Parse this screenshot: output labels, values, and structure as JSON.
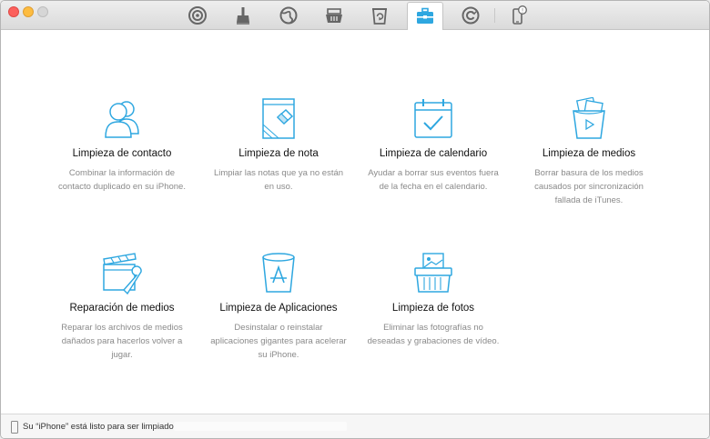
{
  "accent_color": "#2ea7e0",
  "toolbar": {
    "tabs": [
      {
        "name": "tab-signal",
        "icon": "signal-icon"
      },
      {
        "name": "tab-cleaner",
        "icon": "broom-icon"
      },
      {
        "name": "tab-globe",
        "icon": "globe-icon"
      },
      {
        "name": "tab-basket",
        "icon": "basket-icon"
      },
      {
        "name": "tab-trash",
        "icon": "trash-icon"
      },
      {
        "name": "tab-toolbox",
        "icon": "toolbox-icon",
        "active": true
      },
      {
        "name": "tab-refresh",
        "icon": "refresh-icon"
      },
      {
        "name": "tab-device",
        "icon": "phone-alert-icon",
        "badge": "!"
      }
    ]
  },
  "tools": [
    {
      "title": "Limpieza de contacto",
      "desc": "Combinar la información de contacto duplicado en su iPhone.",
      "icon": "contacts-icon"
    },
    {
      "title": "Limpieza de nota",
      "desc": "Limpiar las notas que ya no están en uso.",
      "icon": "note-eraser-icon"
    },
    {
      "title": "Limpieza de calendario",
      "desc": "Ayudar a borrar sus eventos fuera de la fecha en el calendario.",
      "icon": "calendar-check-icon"
    },
    {
      "title": "Limpieza de medios",
      "desc": "Borrar basura de los medios causados por sincronización fallada de iTunes.",
      "icon": "media-bin-icon"
    },
    {
      "title": "Reparación de medios",
      "desc": "Reparar los archivos de medios dañados para hacerlos volver a jugar.",
      "icon": "clapper-wrench-icon"
    },
    {
      "title": "Limpieza de Aplicaciones",
      "desc": "Desinstalar o reinstalar aplicaciones gigantes para acelerar su iPhone.",
      "icon": "app-bin-icon"
    },
    {
      "title": "Limpieza de fotos",
      "desc": "Eliminar las fotografías no deseadas y grabaciones de vídeo.",
      "icon": "photo-shredder-icon"
    }
  ],
  "status": {
    "text": "Su “iPhone” está listo para ser limpiado."
  }
}
